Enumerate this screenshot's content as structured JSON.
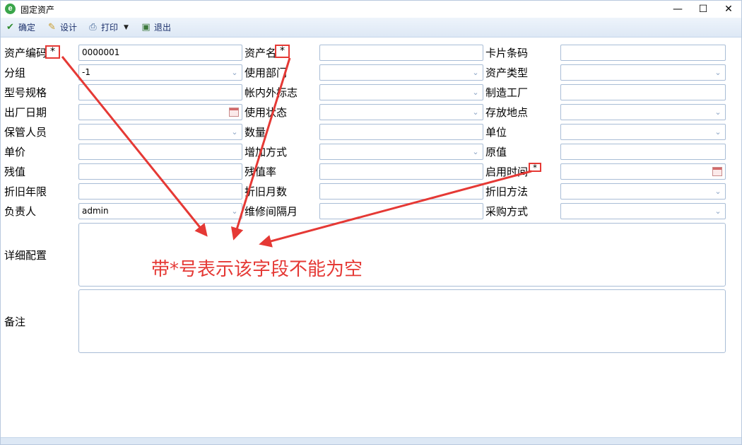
{
  "window": {
    "title": "固定资产",
    "app_icon": "e",
    "minimize_glyph": "—",
    "maximize_glyph": "☐",
    "close_glyph": "✕"
  },
  "toolbar": {
    "confirm_label": "确定",
    "design_label": "设计",
    "print_label": "打印",
    "print_dropdown_glyph": "▼",
    "exit_label": "退出"
  },
  "form": {
    "asset_code": {
      "label": "资产编码",
      "value": "0000001"
    },
    "asset_name": {
      "label": "资产名",
      "value": ""
    },
    "card_barcode": {
      "label": "卡片条码",
      "value": ""
    },
    "group": {
      "label": "分组",
      "value": "-1"
    },
    "using_dept": {
      "label": "使用部门",
      "value": ""
    },
    "asset_type": {
      "label": "资产类型",
      "value": ""
    },
    "model_spec": {
      "label": "型号规格",
      "value": ""
    },
    "in_account_flag": {
      "label": "帐内外标志",
      "value": ""
    },
    "manufacturer": {
      "label": "制造工厂",
      "value": ""
    },
    "factory_date": {
      "label": "出厂日期",
      "value": ""
    },
    "usage_status": {
      "label": "使用状态",
      "value": ""
    },
    "storage_location": {
      "label": "存放地点",
      "value": ""
    },
    "keeper": {
      "label": "保管人员",
      "value": ""
    },
    "quantity": {
      "label": "数量",
      "value": ""
    },
    "unit": {
      "label": "单位",
      "value": ""
    },
    "unit_price": {
      "label": "单价",
      "value": ""
    },
    "increase_method": {
      "label": "增加方式",
      "value": ""
    },
    "original_value": {
      "label": "原值",
      "value": ""
    },
    "residual_value": {
      "label": "残值",
      "value": ""
    },
    "residual_rate": {
      "label": "残值率",
      "value": ""
    },
    "start_date": {
      "label": "启用时间",
      "value": ""
    },
    "depreciation_years": {
      "label": "折旧年限",
      "value": ""
    },
    "depreciation_months": {
      "label": "折旧月数",
      "value": ""
    },
    "depreciation_method": {
      "label": "折旧方法",
      "value": ""
    },
    "responsible_person": {
      "label": "负责人",
      "value": "admin"
    },
    "maintenance_interval": {
      "label": "维修间隔月",
      "value": ""
    },
    "purchase_method": {
      "label": "采购方式",
      "value": ""
    },
    "detail_config": {
      "label": "详细配置",
      "value": ""
    },
    "remarks": {
      "label": "备注",
      "value": ""
    }
  },
  "required_marker": "*",
  "annotation_text": "带*号表示该字段不能为空",
  "colors": {
    "annotation_red": "#e53935",
    "toolbar_bg": "#dde8f5",
    "field_border": "#a9bdd6"
  },
  "icons": {
    "confirm": "check-icon",
    "design": "pencil-icon",
    "print": "printer-icon",
    "exit": "exit-door-icon",
    "dropdown": "chevron-down-icon",
    "date": "calendar-icon"
  }
}
